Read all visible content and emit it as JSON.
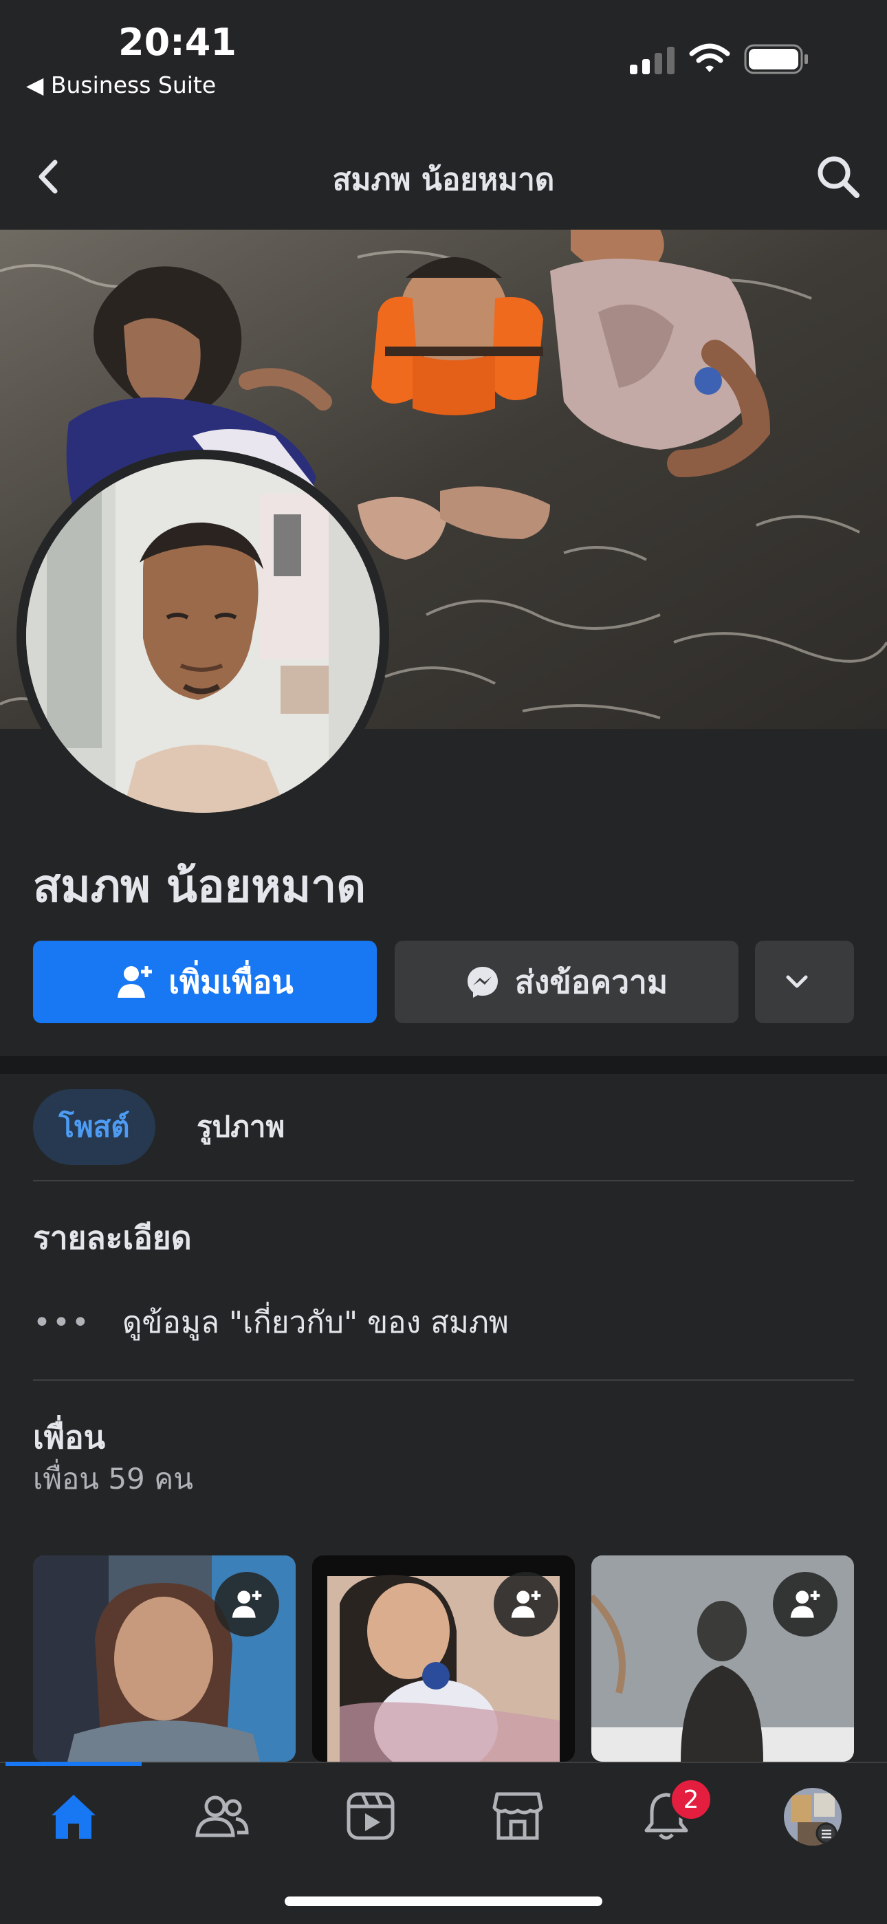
{
  "status_bar": {
    "time": "20:41",
    "back_app": "◀ Business Suite",
    "icons": [
      "cellular-signal-icon",
      "wifi-icon",
      "battery-icon"
    ]
  },
  "nav": {
    "title": "สมภพ น้อยหมาด",
    "back_icon": "chevron-left-icon",
    "search_icon": "search-icon"
  },
  "profile": {
    "name": "สมภพ น้อยหมาด",
    "add_friend_label": "เพิ่มเพื่อน",
    "message_label": "ส่งข้อความ",
    "more_icon": "chevron-down-icon"
  },
  "tabs": [
    {
      "label": "โพสต์",
      "active": true
    },
    {
      "label": "รูปภาพ",
      "active": false
    }
  ],
  "details": {
    "title": "รายละเอียด",
    "dots": "•••",
    "about_link": "ดูข้อมูล \"เกี่ยวกับ\" ของ สมภพ"
  },
  "friends": {
    "title": "เพื่อน",
    "count_text": "เพื่อน 59 คน",
    "cards": [
      {
        "add_icon": "add-friend-icon"
      },
      {
        "add_icon": "add-friend-icon"
      },
      {
        "add_icon": "add-friend-icon"
      }
    ]
  },
  "bottom_tabs": {
    "items": [
      "home-icon",
      "friends-icon",
      "video-icon",
      "marketplace-icon",
      "notifications-icon",
      "menu-avatar"
    ],
    "active": "home-icon",
    "notification_badge": "2"
  },
  "colors": {
    "background": "#242526",
    "accent": "#1877f2",
    "secondary_button": "#3a3b3c",
    "badge": "#e41e3f",
    "active_tab_text": "#4d9bf2"
  }
}
